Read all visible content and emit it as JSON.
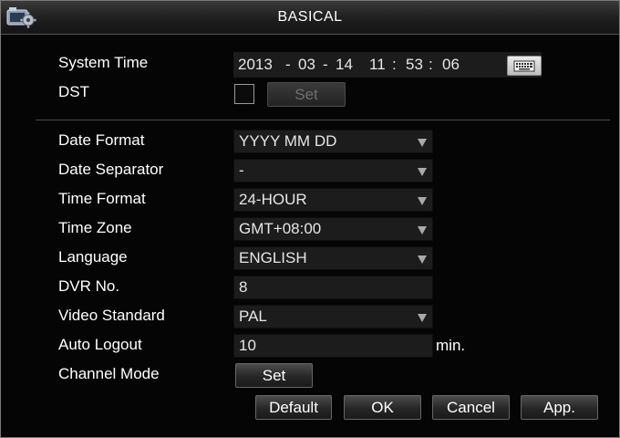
{
  "window": {
    "title": "BASICAL",
    "icon": "settings-gear-icon"
  },
  "system_time": {
    "label": "System Time",
    "year": "2013",
    "month": "03",
    "day": "14",
    "hour": "11",
    "minute": "53",
    "second": "06",
    "date_sep": "-",
    "time_sep": ":",
    "keyboard_icon": "keyboard-icon"
  },
  "dst": {
    "label": "DST",
    "checked": false,
    "set_label": "Set"
  },
  "settings": {
    "date_format": {
      "label": "Date Format",
      "value": "YYYY MM DD"
    },
    "date_separator": {
      "label": "Date Separator",
      "value": "-"
    },
    "time_format": {
      "label": "Time Format",
      "value": "24-HOUR"
    },
    "time_zone": {
      "label": "Time Zone",
      "value": "GMT+08:00"
    },
    "language": {
      "label": "Language",
      "value": "ENGLISH"
    },
    "dvr_no": {
      "label": "DVR No.",
      "value": "8"
    },
    "video_standard": {
      "label": "Video Standard",
      "value": "PAL"
    },
    "auto_logout": {
      "label": "Auto Logout",
      "value": "10",
      "unit": "min."
    },
    "channel_mode": {
      "label": "Channel Mode",
      "set_label": "Set"
    }
  },
  "footer": {
    "default_label": "Default",
    "ok_label": "OK",
    "cancel_label": "Cancel",
    "apply_label": "App."
  },
  "colors": {
    "background": "#050505",
    "field": "#1c1c1c",
    "text": "#ffffff",
    "disabled_text": "#6f6f6f"
  }
}
